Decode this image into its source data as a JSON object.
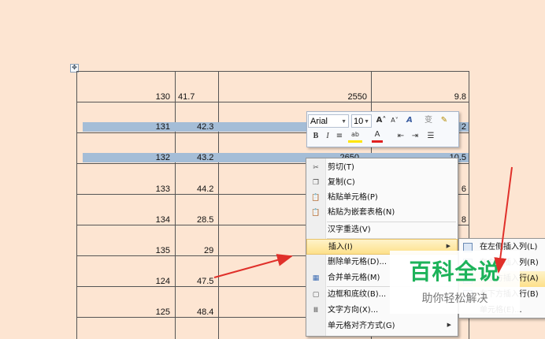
{
  "table": {
    "anchor_icon": "table-move-handle-icon",
    "rows": [
      {
        "c1": "130",
        "c2": "41.7",
        "c3": "2550",
        "c4": "9.8",
        "selected": false
      },
      {
        "c1": "131",
        "c2": "42.3",
        "c3": "",
        "c4": "2",
        "selected": true
      },
      {
        "c1": "132",
        "c2": "43.2",
        "c3": "2650",
        "c4": "10.5",
        "selected": true
      },
      {
        "c1": "133",
        "c2": "44.2",
        "c3": "",
        "c4": "6",
        "selected": false
      },
      {
        "c1": "134",
        "c2": "28.5",
        "c3": "",
        "c4": "8",
        "selected": false
      },
      {
        "c1": "135",
        "c2": "29",
        "c3": "",
        "c4": "",
        "selected": false
      },
      {
        "c1": "124",
        "c2": "47.5",
        "c3": "",
        "c4": "",
        "selected": false
      },
      {
        "c1": "125",
        "c2": "48.4",
        "c3": "",
        "c4": "",
        "selected": false
      }
    ],
    "selection_color": "#a4bdd7"
  },
  "mini_toolbar": {
    "font_name": "Arial",
    "font_size": "10",
    "icons": [
      "grow-font-icon",
      "shrink-font-icon",
      "styles-icon",
      "phonetic-guide-icon",
      "format-painter-icon",
      "bold-icon",
      "italic-icon",
      "center-align-icon",
      "highlight-color-icon",
      "font-color-icon",
      "decrease-indent-icon",
      "increase-indent-icon",
      "bullets-icon"
    ],
    "row1_glyphs": {
      "grow": "A˄",
      "shrink": "A˅",
      "styles": "A",
      "phonetic": "变",
      "painter": "✎"
    },
    "row2_glyphs": {
      "bold": "B",
      "italic": "I",
      "center": "≡",
      "highlight": "ab",
      "fontcolor": "A",
      "dec_indent": "⇤",
      "inc_indent": "⇥",
      "bullets": "☰"
    }
  },
  "context_menu": {
    "items": [
      {
        "label": "剪切(T)",
        "icon": "cut-icon",
        "glyph": "✂"
      },
      {
        "label": "复制(C)",
        "icon": "copy-icon",
        "glyph": "❐"
      },
      {
        "label": "粘贴单元格(P)",
        "icon": "paste-cells-icon",
        "glyph": "📋"
      },
      {
        "label": "粘贴为嵌套表格(N)",
        "icon": "paste-nested-icon",
        "glyph": "📋"
      },
      {
        "label": "汉字重选(V)",
        "icon": "",
        "glyph": ""
      },
      {
        "label": "插入(I)",
        "icon": "",
        "glyph": "",
        "submenu": true,
        "highlighted": true
      },
      {
        "label": "删除单元格(D)...",
        "icon": "",
        "glyph": ""
      },
      {
        "label": "合并单元格(M)",
        "icon": "merge-cells-icon",
        "glyph": "▦"
      },
      {
        "label": "边框和底纹(B)...",
        "icon": "borders-icon",
        "glyph": "▢"
      },
      {
        "label": "文字方向(X)...",
        "icon": "text-direction-icon",
        "glyph": "Ⅲ"
      },
      {
        "label": "单元格对齐方式(G)",
        "icon": "",
        "glyph": "",
        "submenu": true
      }
    ]
  },
  "submenu": {
    "items": [
      {
        "label": "在左侧插入列(L)",
        "highlighted": false
      },
      {
        "label": "在右侧插入列(R)",
        "highlighted": false
      },
      {
        "label": "在上方插入行(A)",
        "highlighted": true
      },
      {
        "label": "在下方插入行(B)",
        "highlighted": false
      },
      {
        "label": "单元格(E)...",
        "highlighted": false
      }
    ]
  },
  "watermark": {
    "title": "百科全说",
    "subtitle": "助你轻松解决",
    "color": "#1db35a"
  },
  "annotations": {
    "arrow_color": "#e0302a"
  }
}
